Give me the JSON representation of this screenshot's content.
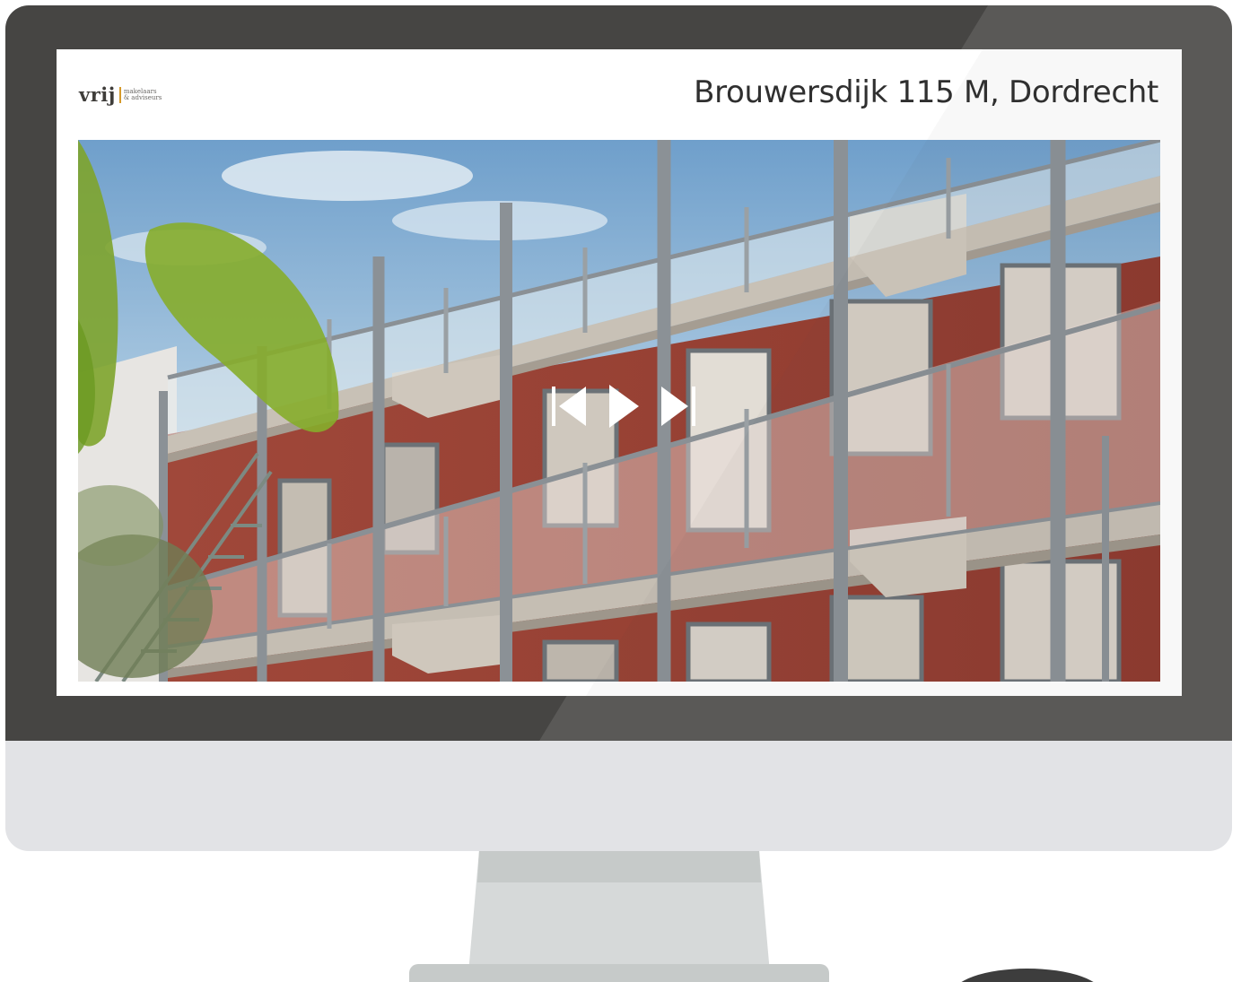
{
  "logo": {
    "word": "vrij",
    "line1": "makelaars",
    "line2": "& adviseurs"
  },
  "listing": {
    "title": "Brouwersdijk 115 M, Dordrecht"
  },
  "slideshow": {
    "controls": {
      "previous_icon": "skip-previous-icon",
      "play_icon": "play-icon",
      "next_icon": "skip-next-icon"
    }
  },
  "colors": {
    "bezel": "#464543",
    "chin": "#e2e3e6",
    "brand_accent": "#d59a2a",
    "title_text": "#2f2f2f"
  }
}
